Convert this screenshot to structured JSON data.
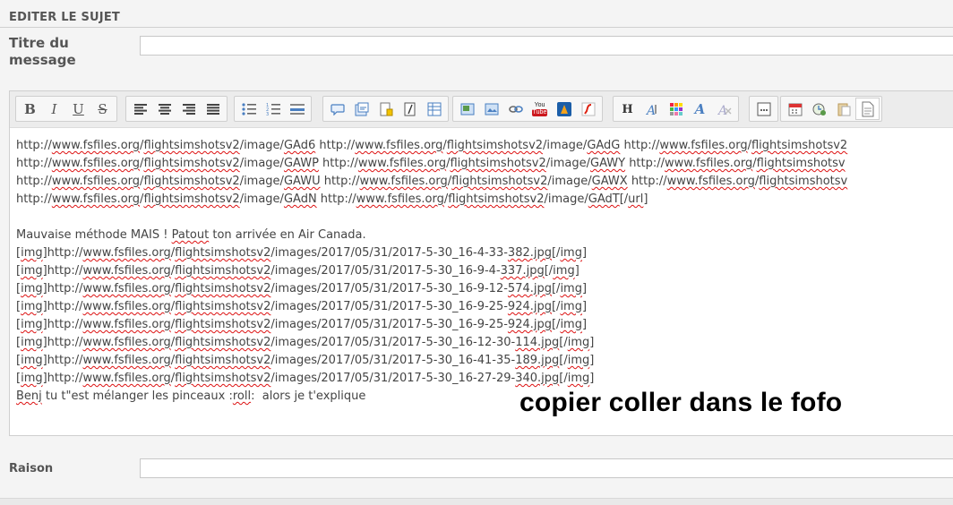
{
  "section_title": "EDITER LE SUJET",
  "fields": {
    "titre_label": "Titre du message",
    "titre_value": "",
    "raison_label": "Raison",
    "raison_value": ""
  },
  "toolbar": {
    "groups": [
      [
        "bold-icon",
        "italic-icon",
        "underline-icon",
        "strikethrough-icon"
      ],
      [
        "align-left-icon",
        "align-center-icon",
        "align-right-icon",
        "align-justify-icon"
      ],
      [
        "bullet-list-icon",
        "numbered-list-icon",
        "horizontal-rule-icon"
      ],
      [
        "quote-icon",
        "spoiler-icon",
        "hide-icon",
        "code-icon",
        "table-icon"
      ],
      [
        "image-upload-icon",
        "image-icon",
        "link-icon",
        "youtube-icon",
        "dailymotion-icon",
        "flash-icon"
      ],
      [
        "heading-icon",
        "font-size-icon",
        "color-icon",
        "font-icon",
        "remove-format-icon"
      ],
      [
        "ellipsis-icon"
      ],
      [
        "calendar-icon",
        "preview-icon",
        "paste-icon",
        "source-icon"
      ]
    ],
    "youtube_text": "You Tube"
  },
  "content": {
    "lines": [
      "http://www.fsfiles.org/flightsimshotsv2/image/GAd6 http://www.fsfiles.org/flightsimshotsv2/image/GAdG http://www.fsfiles.org/flightsimshotsv2",
      "http://www.fsfiles.org/flightsimshotsv2/image/GAWP http://www.fsfiles.org/flightsimshotsv2/image/GAWY http://www.fsfiles.org/flightsimshotsv",
      "http://www.fsfiles.org/flightsimshotsv2/image/GAWU http://www.fsfiles.org/flightsimshotsv2/image/GAWX http://www.fsfiles.org/flightsimshotsv",
      "http://www.fsfiles.org/flightsimshotsv2/image/GAdN http://www.fsfiles.org/flightsimshotsv2/image/GAdT[/url]",
      "",
      "Mauvaise méthode MAIS ! Patout ton arrivée en Air Canada.",
      "[img]http://www.fsfiles.org/flightsimshotsv2/images/2017/05/31/2017-5-30_16-4-33-382.jpg[/img]",
      "[img]http://www.fsfiles.org/flightsimshotsv2/images/2017/05/31/2017-5-30_16-9-4-337.jpg[/img]",
      "[img]http://www.fsfiles.org/flightsimshotsv2/images/2017/05/31/2017-5-30_16-9-12-574.jpg[/img]",
      "[img]http://www.fsfiles.org/flightsimshotsv2/images/2017/05/31/2017-5-30_16-9-25-924.jpg[/img]",
      "[img]http://www.fsfiles.org/flightsimshotsv2/images/2017/05/31/2017-5-30_16-9-25-924.jpg[/img]",
      "[img]http://www.fsfiles.org/flightsimshotsv2/images/2017/05/31/2017-5-30_16-12-30-114.jpg[/img]",
      "[img]http://www.fsfiles.org/flightsimshotsv2/images/2017/05/31/2017-5-30_16-41-35-189.jpg[/img]",
      "[img]http://www.fsfiles.org/flightsimshotsv2/images/2017/05/31/2017-5-30_16-27-29-340.jpg[/img]",
      "Benj tu t\"est mélanger les pinceaux :roll:  alors je t'explique"
    ],
    "spellcheck_words": [
      "www.fsfiles.org",
      "flightsimshotsv2",
      "flightsimshotsv",
      "GAd6",
      "GAdG",
      "GAWP",
      "GAWY",
      "GAWU",
      "GAWX",
      "GAdN",
      "GAdT",
      "url",
      "Patout",
      "img",
      "Benj",
      "roll",
      "382.jpg",
      "337.jpg",
      "574.jpg",
      "924.jpg",
      "114.jpg",
      "189.jpg",
      "340.jpg"
    ]
  },
  "overlay_text": "copier coller dans le fofo",
  "colors": {
    "panel_bg": "#f4f4f4",
    "toolbar_bg": "#ececec",
    "spell_underline": "#dd1111",
    "youtube_red": "#cc181e",
    "icon_blue": "#4a7fc1"
  }
}
